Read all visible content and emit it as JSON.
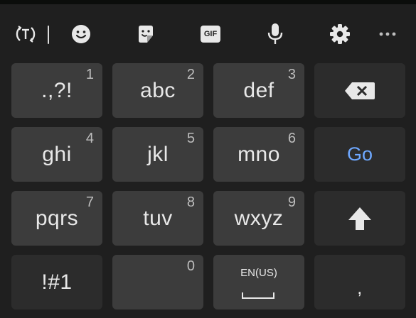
{
  "toolbar": {
    "items": [
      {
        "icon": "translate-icon"
      },
      {
        "icon": "emoji-icon"
      },
      {
        "icon": "sticker-icon"
      },
      {
        "icon": "gif-icon",
        "label": "GIF"
      },
      {
        "icon": "microphone-icon"
      },
      {
        "icon": "settings-gear-icon"
      },
      {
        "icon": "more-options-icon"
      }
    ]
  },
  "keys": {
    "k1": {
      "label": ".,?!",
      "num": "1"
    },
    "k2": {
      "label": "abc",
      "num": "2"
    },
    "k3": {
      "label": "def",
      "num": "3"
    },
    "k4": {
      "label": "ghi",
      "num": "4"
    },
    "k5": {
      "label": "jkl",
      "num": "5"
    },
    "k6": {
      "label": "mno",
      "num": "6"
    },
    "k7": {
      "label": "pqrs",
      "num": "7"
    },
    "k8": {
      "label": "tuv",
      "num": "8"
    },
    "k9": {
      "label": "wxyz",
      "num": "9"
    },
    "k0": {
      "num": "0"
    },
    "symbols": {
      "label": "!#1"
    },
    "go": {
      "label": "Go"
    },
    "space": {
      "label": "EN(US)"
    },
    "comma": {
      "label": ","
    },
    "backspace": {
      "icon": "backspace-icon"
    },
    "shift": {
      "icon": "shift-arrow-icon"
    }
  },
  "colors": {
    "background": "#1f1f1f",
    "key": "#3c3c3c",
    "function_key": "#2c2c2c",
    "accent": "#6ea8ff",
    "text": "#e8e8e8"
  }
}
